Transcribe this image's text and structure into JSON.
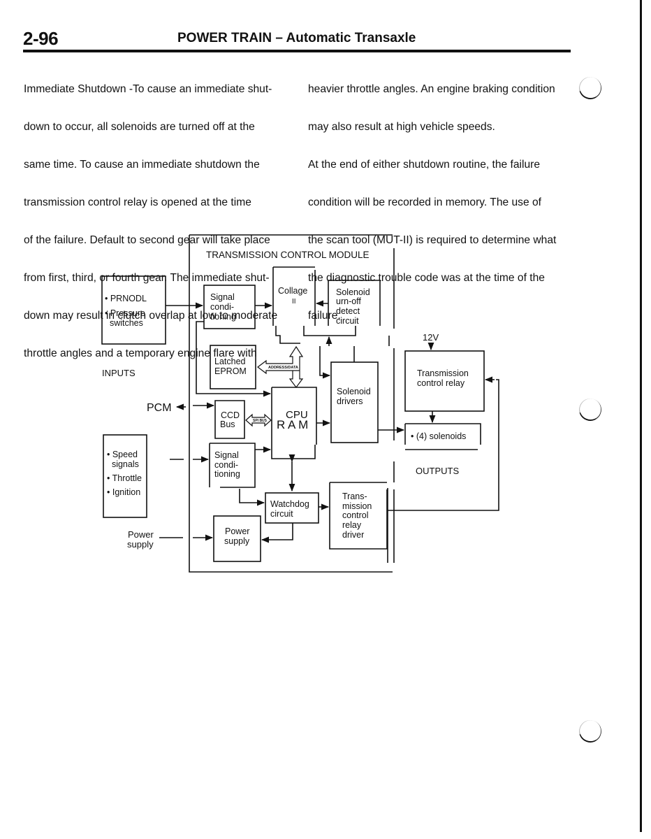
{
  "header": {
    "page_number": "2-96",
    "title": "POWER TRAIN – Automatic Transaxle"
  },
  "body": {
    "left_column": [
      "Immediate Shutdown -To cause an immediate shut-",
      "down to occur, all solenoids are turned off at the",
      "same time. To cause an immediate shutdown the",
      "transmission control relay is opened at the time",
      "of the failure. Default to second gear will take place",
      "from first, third, or fourth gear. The immediate shut-",
      "down may result in clutch overlap at low to moderate",
      "throttle angles and a temporary engine flare with"
    ],
    "right_column": [
      "heavier throttle angles. An engine braking condition",
      "may also result at high vehicle speeds.",
      "At the end of either shutdown routine, the failure",
      "condition will be recorded in memory. The use of",
      "the scan tool (MUT-II) is required to determine what",
      "the diagnostic trouble code was at the time of the",
      "failure."
    ]
  },
  "diagram": {
    "module_title": "TRANSMISSION CONTROL MODULE",
    "inputs_label": "INPUTS",
    "outputs_label": "OUTPUTS",
    "input_box_1": [
      "• PRNODL",
      "• Pressure",
      "  switches"
    ],
    "input_box_2": [
      "• Speed",
      "  signals",
      "• Throttle",
      "• Ignition"
    ],
    "pcm_label": "PCM",
    "power_in_label": [
      "Power",
      "supply"
    ],
    "signal_cond_1": [
      "Signal",
      "condi-",
      "tioning"
    ],
    "signal_cond_2": [
      "Signal",
      "condi-",
      "tioning"
    ],
    "collage": [
      "Collage",
      "II"
    ],
    "solenoid_detect": [
      "Solenoid",
      "urn-off",
      "detect",
      "circuit"
    ],
    "latched_eprom": [
      "Latched",
      "EPROM"
    ],
    "address_data_bus": "ADDRESS/DATA",
    "ccd_bus": [
      "CCD",
      "Bus"
    ],
    "spi_bus": "SPI BUS",
    "cpu": [
      "CPU",
      "R A M"
    ],
    "solenoid_drivers": [
      "Solenoid",
      "drivers"
    ],
    "watchdog": [
      "Watchdog",
      "circuit"
    ],
    "power_supply": [
      "Power",
      "supply"
    ],
    "relay_driver": [
      "Trans-",
      "mission",
      "control",
      "relay",
      "driver"
    ],
    "voltage_label": "12V",
    "relay_box": [
      "Transmission",
      "control relay"
    ],
    "solenoids_box": "• (4) solenoids"
  }
}
